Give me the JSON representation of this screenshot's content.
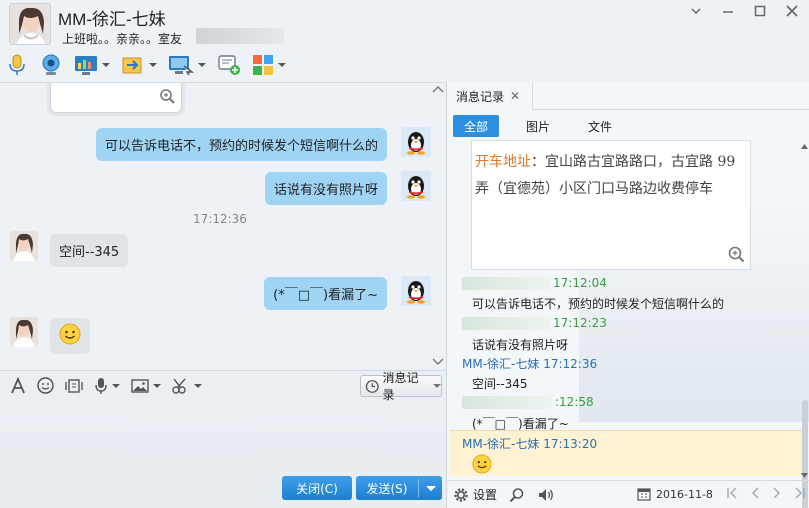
{
  "header": {
    "title": "MM-徐汇-七妹",
    "signature": "上班啦。。亲亲。。室友"
  },
  "chat": {
    "messages": [
      {
        "side": "right",
        "text": "可以告诉电话不，预约的时候发个短信啊什么的"
      },
      {
        "side": "right",
        "text": "话说有没有照片呀"
      },
      {
        "side": "left",
        "text": "空间--345"
      },
      {
        "side": "right",
        "text": "(*￣□￣)看漏了~"
      },
      {
        "side": "left",
        "text": "🙂"
      }
    ],
    "time": "17:12:36"
  },
  "input_toolbar": {
    "history_label": "消息记录"
  },
  "buttons": {
    "close_label": "关闭(C)",
    "send_label": "发送(S)"
  },
  "panel": {
    "tab_label": "消息记录",
    "filters": [
      "全部",
      "图片",
      "文件"
    ],
    "card": {
      "highlight": "开车地址",
      "line1": "：宜山路古宜路路口，古宜路 99",
      "line2": "弄（宜德苑）小区门口马路边收费停车"
    },
    "history": [
      {
        "name": "",
        "time": "17:12:04",
        "text": "可以告诉电话不，预约的时候发个短信啊什么的"
      },
      {
        "name": "",
        "time": "17:12:23",
        "text": "话说有没有照片呀"
      },
      {
        "name": "MM-徐汇-七妹",
        "time": "17:12:36",
        "text": "空间--345"
      },
      {
        "name": "",
        "time": ":12:58",
        "text": "(*￣□￣)看漏了~"
      },
      {
        "name": "MM-徐汇-七妹",
        "time": "17:13:20",
        "text": "😊"
      }
    ],
    "footer": {
      "settings_label": "设置",
      "date": "2016-11-8"
    }
  },
  "colors": {
    "bubble_self": "#9fd4f5",
    "bubble_other": "#dfe4e8",
    "accent": "#2d8fdf",
    "highlight": "#e07a25"
  }
}
